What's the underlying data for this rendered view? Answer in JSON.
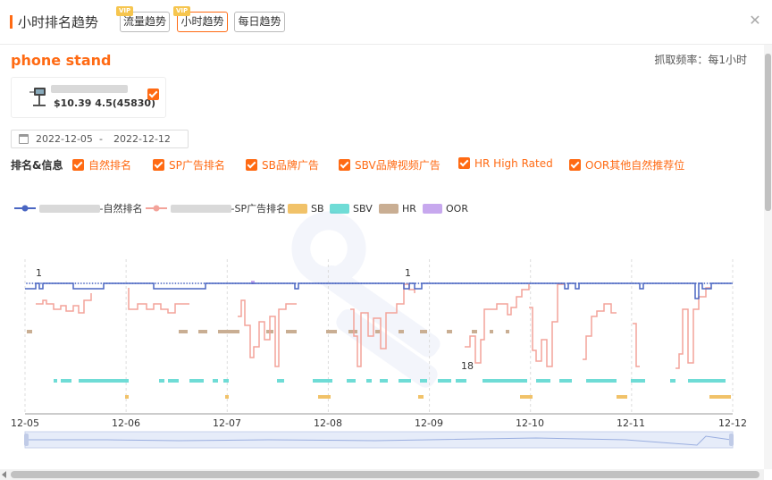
{
  "header": {
    "title": "小时排名趋势",
    "tabs": [
      {
        "label": "流量趋势",
        "vip": "VIP",
        "active": false
      },
      {
        "label": "小时趋势",
        "vip": "VIP",
        "active": true
      },
      {
        "label": "每日趋势",
        "vip": "",
        "active": false
      }
    ],
    "close_icon": "close-icon"
  },
  "keyword": "phone stand",
  "frequency": "抓取频率：每1小时",
  "product": {
    "meta": "$10.39 4.5(45830)",
    "checked": true
  },
  "date_range": {
    "start": "2022-12-05",
    "separator": "-",
    "end": "2022-12-12"
  },
  "filters": {
    "label": "排名&信息",
    "items": [
      "自然排名",
      "SP广告排名",
      "SB品牌广告",
      "SBV品牌视频广告",
      "HR High Rated",
      "OOR其他自然推荐位"
    ]
  },
  "legend": {
    "organic_suffix": "-自然排名",
    "sp_suffix": "-SP广告排名",
    "sb": "SB",
    "sbv": "SBV",
    "hr": "HR",
    "oor": "OOR"
  },
  "colors": {
    "accent": "#ff6a13",
    "organic": "#4a66c2",
    "sp": "#f3a39a",
    "sb": "#f1c269",
    "sbv": "#6fdcd6",
    "hr": "#c9ae93",
    "oor": "#c7a8ee"
  },
  "chart_data": {
    "type": "line",
    "x_ticks": [
      "12-05",
      "12-06",
      "12-07",
      "12-08",
      "12-09",
      "12-10",
      "12-11",
      "12-12"
    ],
    "annotations": [
      "1",
      "1",
      "18"
    ],
    "series": [
      {
        "name": "自然排名"
      },
      {
        "name": "SP广告排名"
      },
      {
        "name": "SB"
      },
      {
        "name": "SBV"
      },
      {
        "name": "HR"
      },
      {
        "name": "OOR"
      }
    ]
  }
}
